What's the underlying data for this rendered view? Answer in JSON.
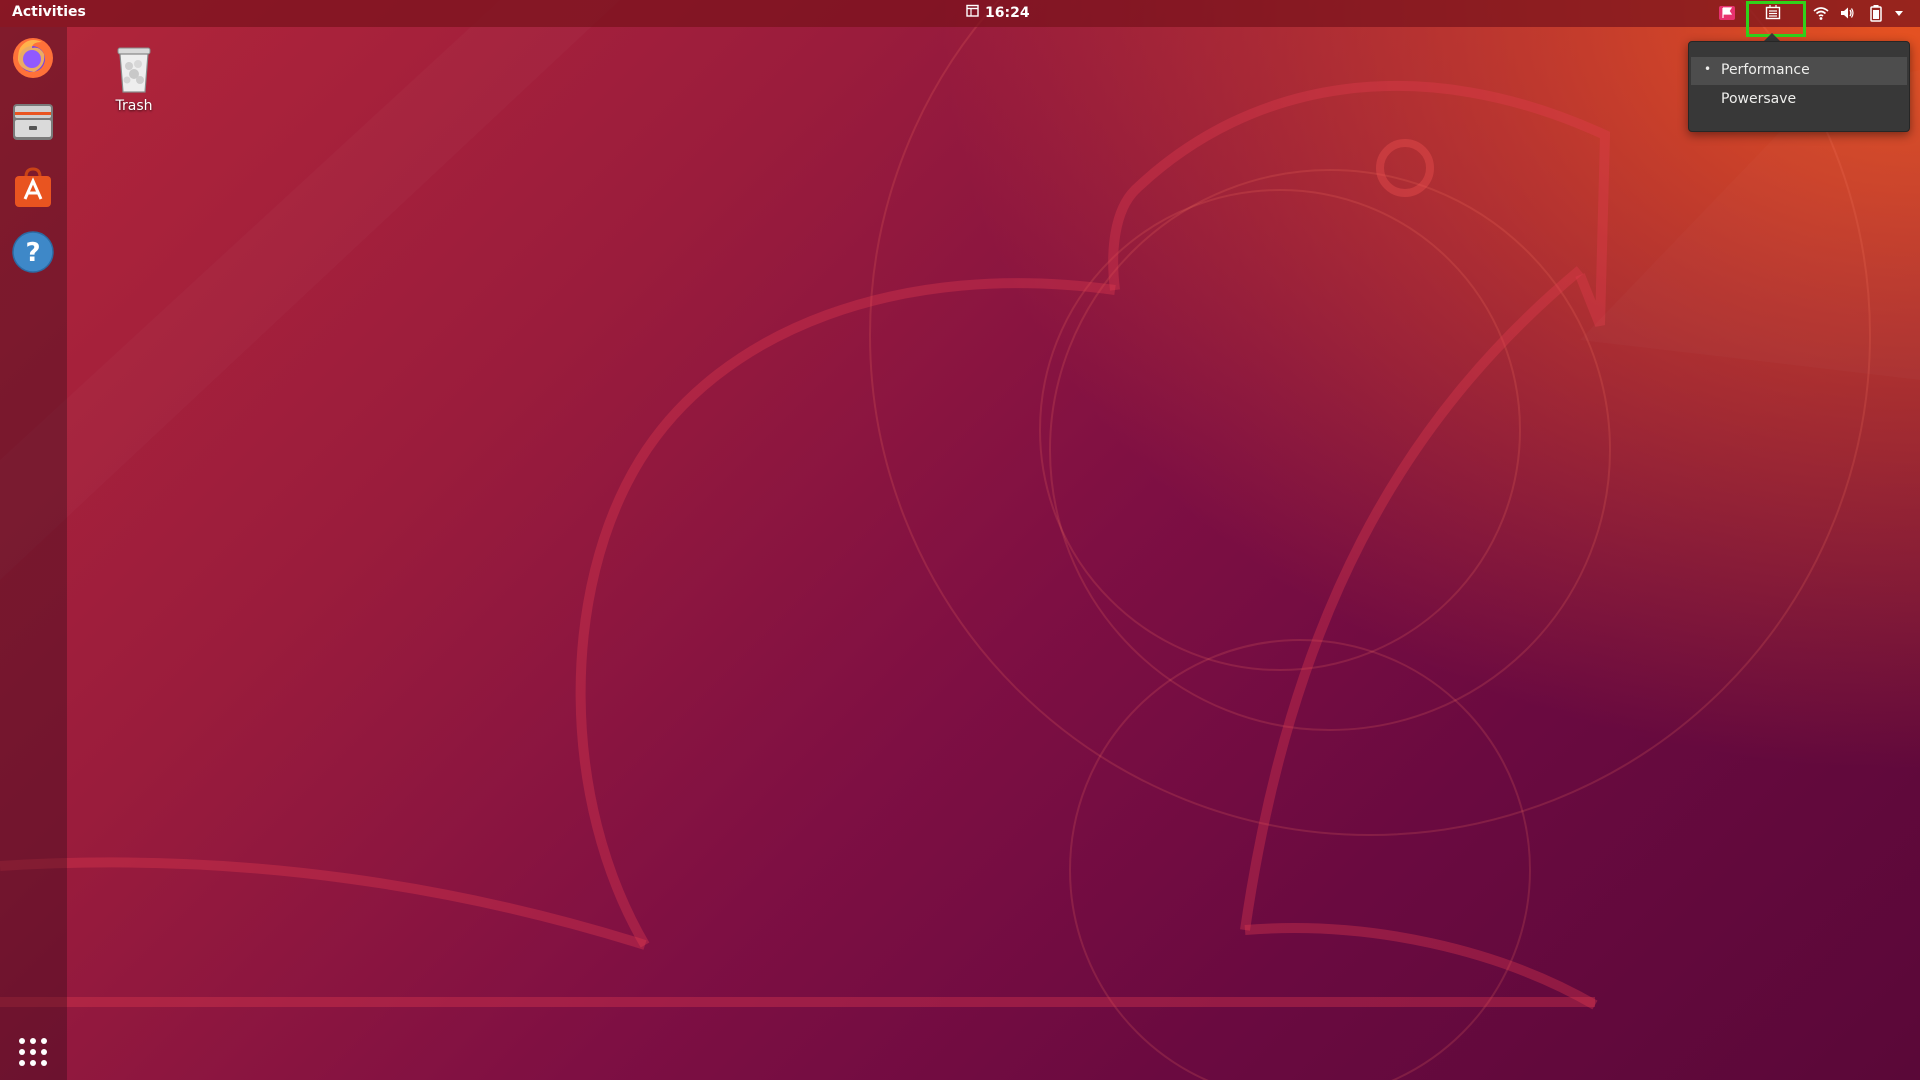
{
  "topbar": {
    "activities_label": "Activities",
    "clock": "16:24",
    "icons": [
      "calendar-icon",
      "notification-flag-icon",
      "cpu-frequency-icon",
      "wifi-icon",
      "volume-icon",
      "battery-icon",
      "system-menu-arrow-icon"
    ]
  },
  "dock": {
    "items": [
      {
        "name": "Firefox",
        "icon": "firefox-icon"
      },
      {
        "name": "Files",
        "icon": "files-icon"
      },
      {
        "name": "Ubuntu Software",
        "icon": "software-icon"
      },
      {
        "name": "Help",
        "icon": "help-icon"
      }
    ],
    "show_apps_icon": "app-grid-icon"
  },
  "desktop": {
    "trash_label": "Trash"
  },
  "cpu_menu": {
    "items": [
      {
        "label": "Performance",
        "selected": true
      },
      {
        "label": "Powersave",
        "selected": false
      }
    ],
    "bullet": "•"
  },
  "colors": {
    "accent": "#e95420",
    "highlight": "#31d21a",
    "menu_bg": "#383838"
  }
}
